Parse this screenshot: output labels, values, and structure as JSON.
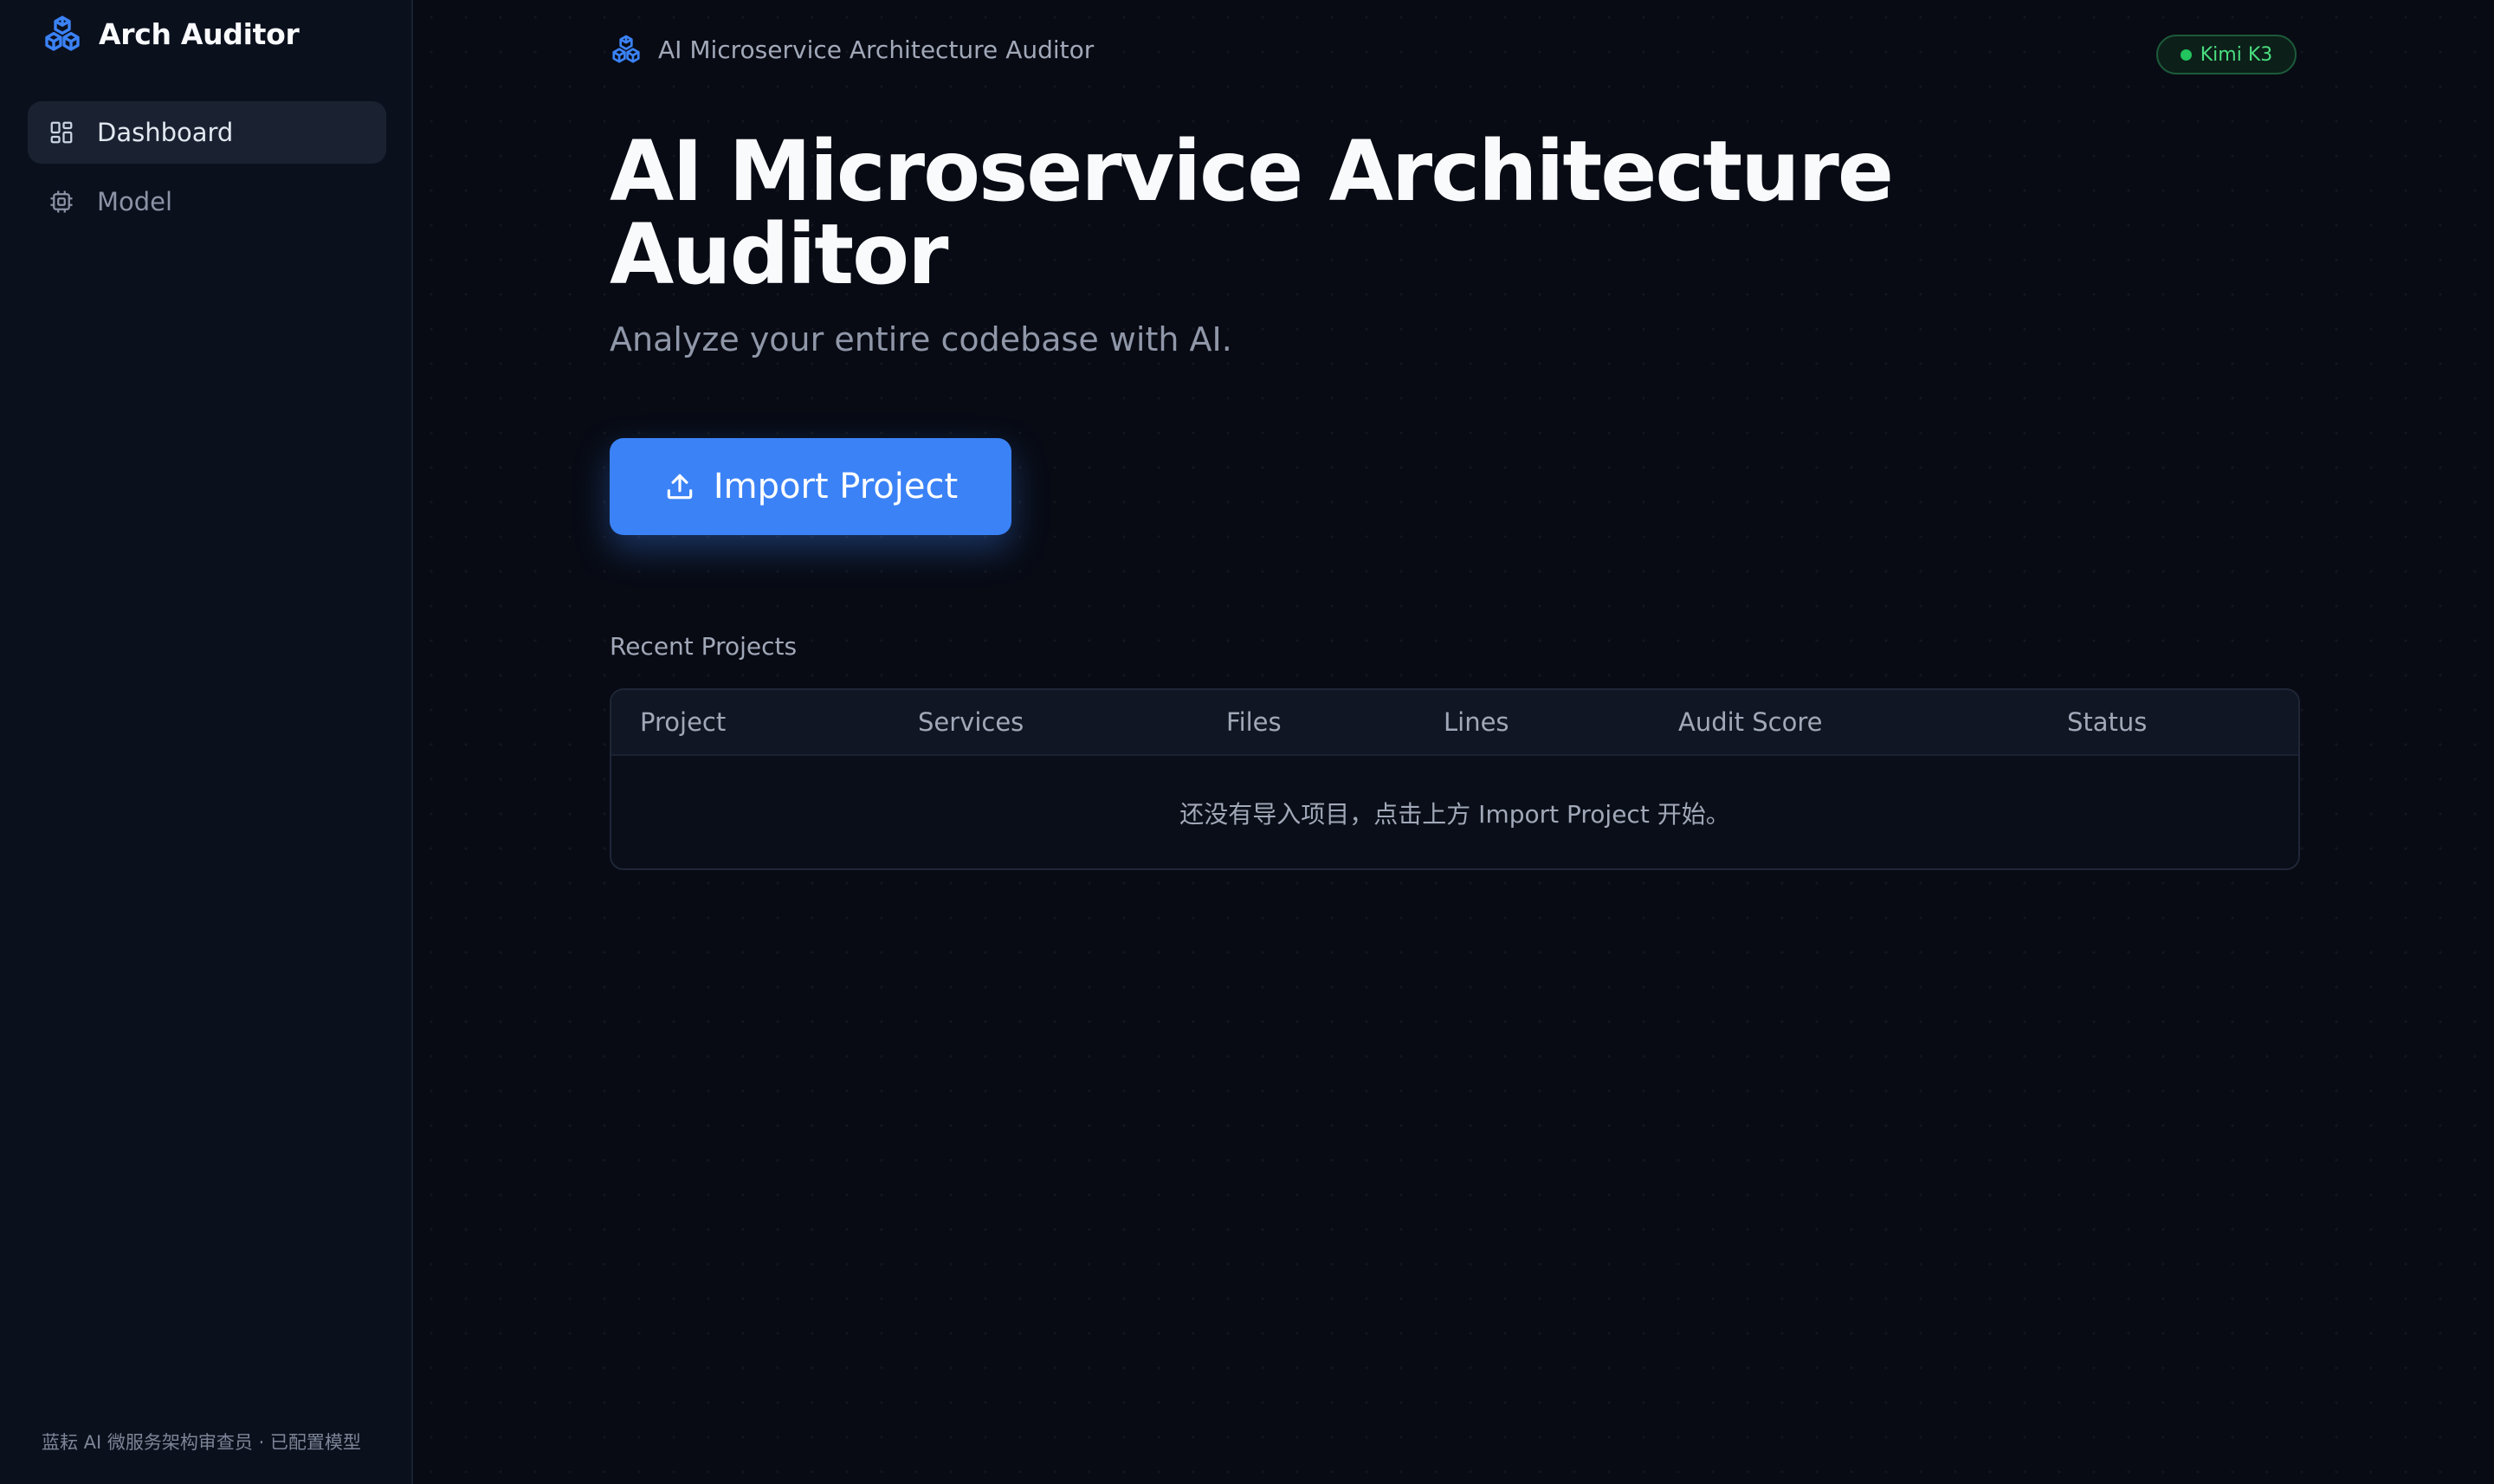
{
  "app": {
    "brand_name": "Arch Auditor",
    "accent_color": "#3b82f6"
  },
  "sidebar": {
    "items": [
      {
        "label": "Dashboard",
        "icon": "dashboard-grid-icon",
        "active": true
      },
      {
        "label": "Model",
        "icon": "cpu-chip-icon",
        "active": false
      }
    ],
    "footer": "蓝耘 AI 微服务架构审查员 · 已配置模型"
  },
  "header": {
    "title": "AI Microservice Architecture Auditor",
    "icon": "cubes-logo-icon",
    "model_badge": {
      "label": "Kimi K3",
      "status_color": "#22c55e"
    }
  },
  "hero": {
    "title": "AI Microservice Architecture Auditor",
    "subtitle": "Analyze your entire codebase with AI.",
    "import_button": {
      "label": "Import Project",
      "icon": "upload-icon"
    }
  },
  "recent_projects": {
    "label": "Recent Projects",
    "columns": [
      "Project",
      "Services",
      "Files",
      "Lines",
      "Audit Score",
      "Status"
    ],
    "rows": [],
    "empty_message": "还没有导入项目，点击上方 Import Project 开始。"
  }
}
